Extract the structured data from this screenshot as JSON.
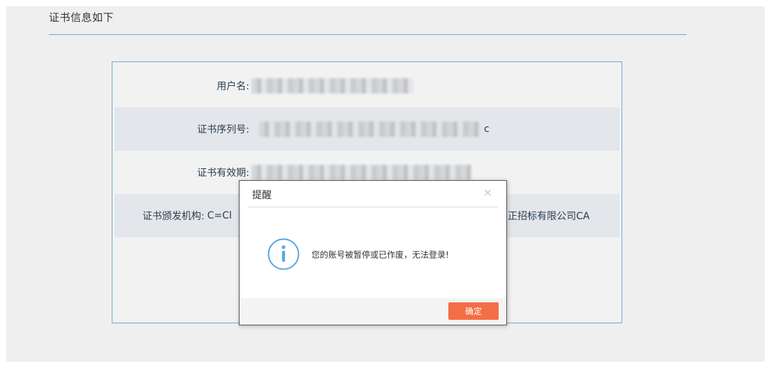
{
  "section": {
    "title": "证书信息如下"
  },
  "cert_info": {
    "rows": [
      {
        "label": "用户名:",
        "value_suffix": ""
      },
      {
        "label": "证书序列号:",
        "value_suffix": "c"
      },
      {
        "label": "证书有效期:",
        "value_suffix": ""
      },
      {
        "label": "证书颁发机构:",
        "value_prefix": "C=Cl",
        "value_suffix": "正招标有限公司CA"
      }
    ]
  },
  "dialog": {
    "title": "提醒",
    "close_glyph": "×",
    "message": "您的账号被暂停或已作废，无法登录!",
    "ok_label": "确定"
  },
  "colors": {
    "accent_blue": "#6aaad6",
    "ok_button": "#f46e45",
    "info_icon": "#5aa8e0"
  }
}
